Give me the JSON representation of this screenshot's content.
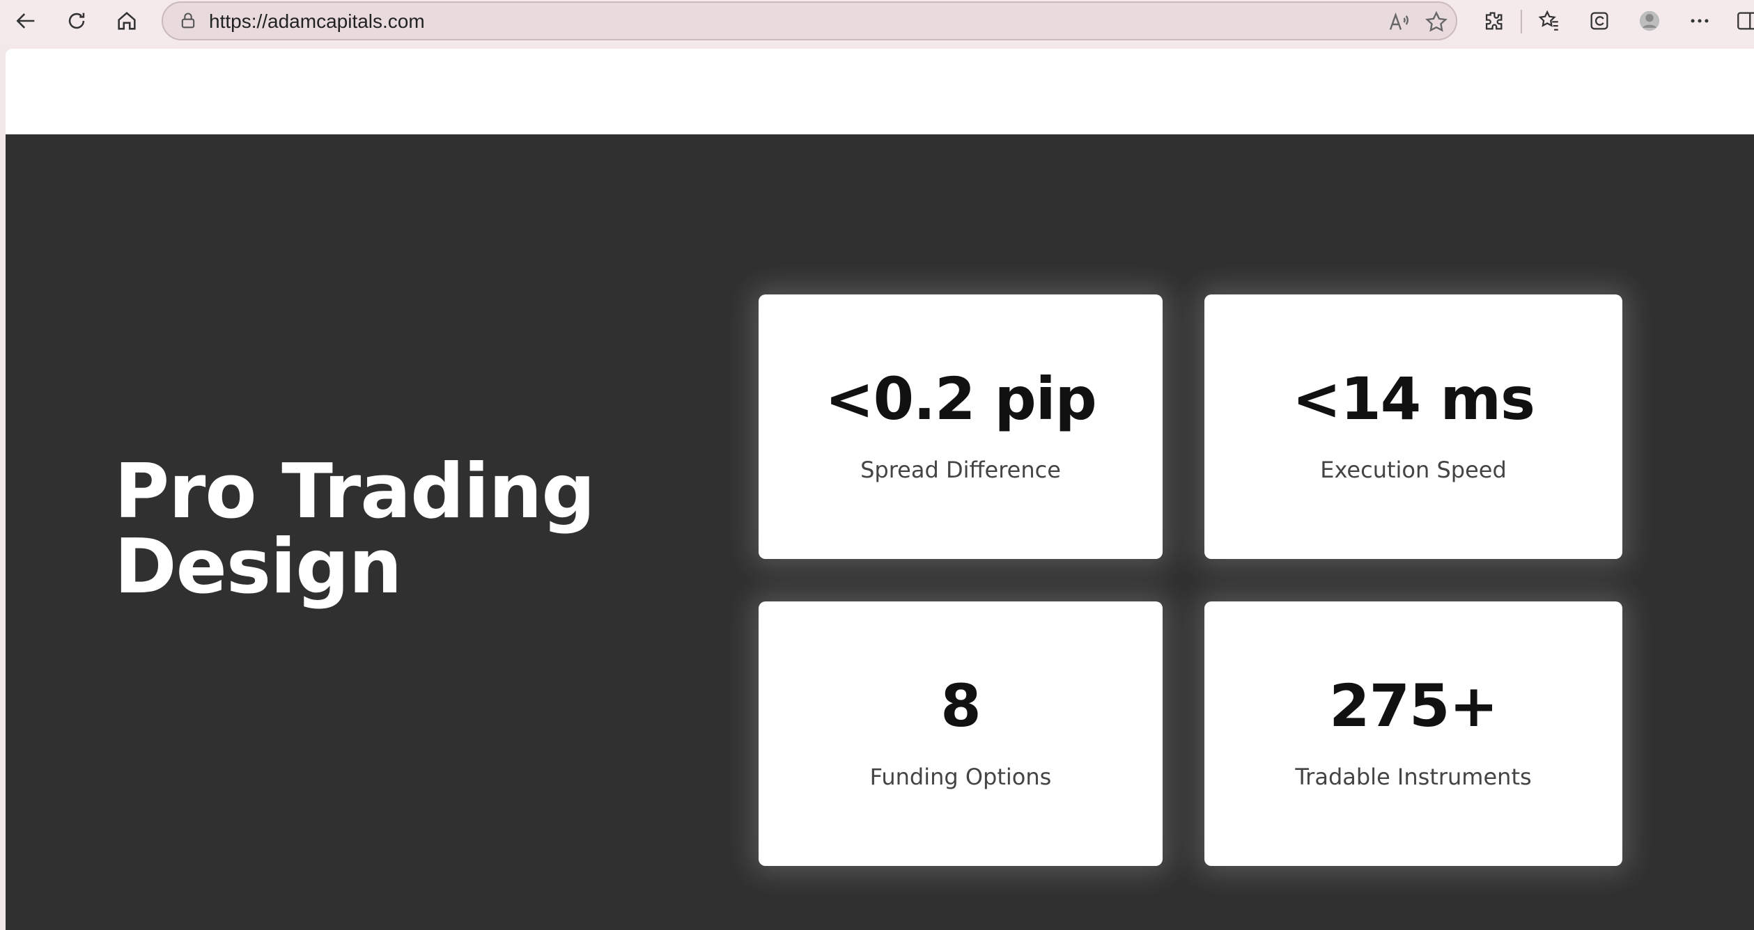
{
  "browser": {
    "url": "https://adamcapitals.com"
  },
  "hero": {
    "title_line1": "Pro Trading",
    "title_line2": "Design"
  },
  "stats": [
    {
      "value": "<0.2 pip",
      "label": "Spread Difference"
    },
    {
      "value": "<14 ms",
      "label": "Execution Speed"
    },
    {
      "value": "8",
      "label": "Funding Options"
    },
    {
      "value": "275+",
      "label": "Tradable Instruments"
    }
  ],
  "colors": {
    "hero_background": "#303030",
    "card_background": "#ffffff",
    "chrome_background": "#f4eaeb"
  },
  "icons": [
    "back-icon",
    "refresh-icon",
    "home-icon",
    "lock-icon",
    "read-aloud-icon",
    "favorite-star-icon",
    "extensions-icon",
    "favorites-icon",
    "collections-icon",
    "profile-icon",
    "more-icon",
    "sidebar-icon"
  ]
}
